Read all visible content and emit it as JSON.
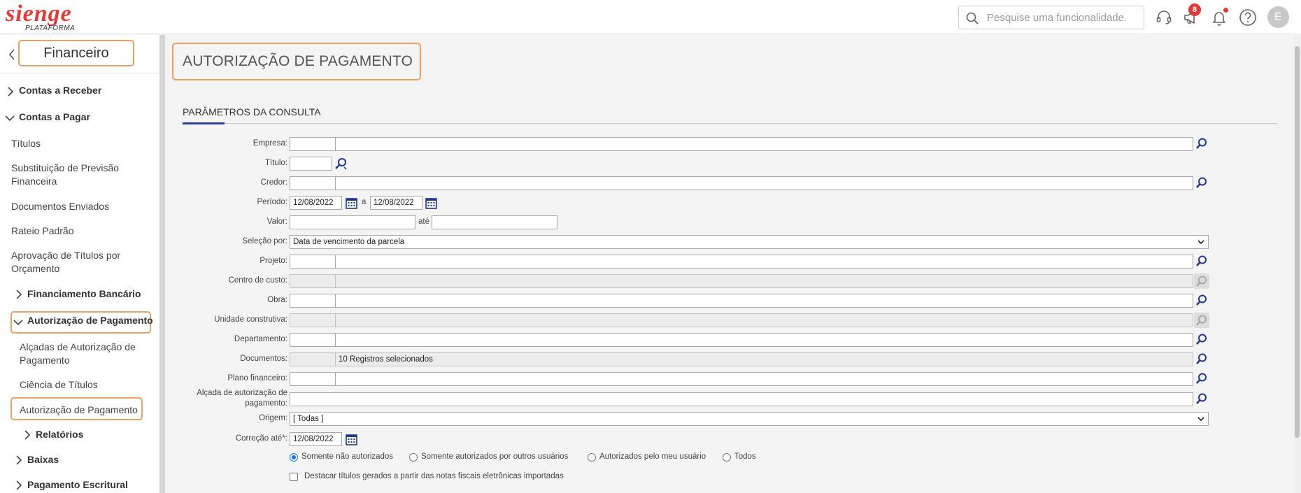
{
  "header": {
    "logo_text": "sienge",
    "logo_sub": "PLATAFORMA",
    "search_placeholder": "Pesquise uma funcionalidade.",
    "notifications_count": "8",
    "avatar_initial": "E"
  },
  "sidebar": {
    "module_title": "Financeiro",
    "items": [
      {
        "label": "Contas a Receber"
      },
      {
        "label": "Contas a Pagar"
      },
      {
        "label": "Títulos"
      },
      {
        "label": "Substituição de Previsão Financeira"
      },
      {
        "label": "Documentos Enviados"
      },
      {
        "label": "Rateio Padrão"
      },
      {
        "label": "Aprovação de Títulos por Orçamento"
      },
      {
        "label": "Financiamento Bancário"
      },
      {
        "label": "Autorização de Pagamento"
      },
      {
        "label": "Alçadas de Autorização de Pagamento"
      },
      {
        "label": "Ciência de Títulos"
      },
      {
        "label": "Autorização de Pagamento"
      },
      {
        "label": "Relatórios"
      },
      {
        "label": "Baixas"
      },
      {
        "label": "Pagamento Escritural"
      }
    ]
  },
  "main": {
    "page_title": "AUTORIZAÇÃO DE PAGAMENTO",
    "section_title": "PARÂMETROS DA CONSULTA",
    "fields": {
      "empresa": {
        "label": "Empresa:"
      },
      "titulo": {
        "label": "Título:"
      },
      "credor": {
        "label": "Credor:"
      },
      "periodo": {
        "label": "Período:",
        "from": "12/08/2022",
        "sep": "a",
        "to": "12/08/2022"
      },
      "valor": {
        "label": "Valor:",
        "sep": "até"
      },
      "selecao": {
        "label": "Seleção por:",
        "value": "Data de vencimento da parcela"
      },
      "projeto": {
        "label": "Projeto:"
      },
      "centro_custo": {
        "label": "Centro de custo:"
      },
      "obra": {
        "label": "Obra:"
      },
      "unidade": {
        "label": "Unidade construtiva:"
      },
      "departamento": {
        "label": "Departamento:"
      },
      "documentos": {
        "label": "Documentos:",
        "value": "10 Registros selecionados"
      },
      "plano": {
        "label": "Plano financeiro:"
      },
      "alcada": {
        "label_line1": "Alçada de autorização de",
        "label_line2": "pagamento:"
      },
      "origem": {
        "label": "Origem:",
        "value": "[ Todas ]"
      },
      "correcao": {
        "label": "Correção até*:",
        "value": "12/08/2022"
      }
    },
    "radios": [
      {
        "label": "Somente não autorizados",
        "selected": true
      },
      {
        "label": "Somente autorizados por outros usuários",
        "selected": false
      },
      {
        "label": "Autorizados pelo meu usuário",
        "selected": false
      },
      {
        "label": "Todos",
        "selected": false
      }
    ],
    "checkbox_label": "Destacar títulos gerados a partir das notas fiscais eletrônicas importadas"
  },
  "colors": {
    "brand_red": "#e53935",
    "accent_blue": "#2e3f9c",
    "highlight_orange": "#f0a060"
  }
}
